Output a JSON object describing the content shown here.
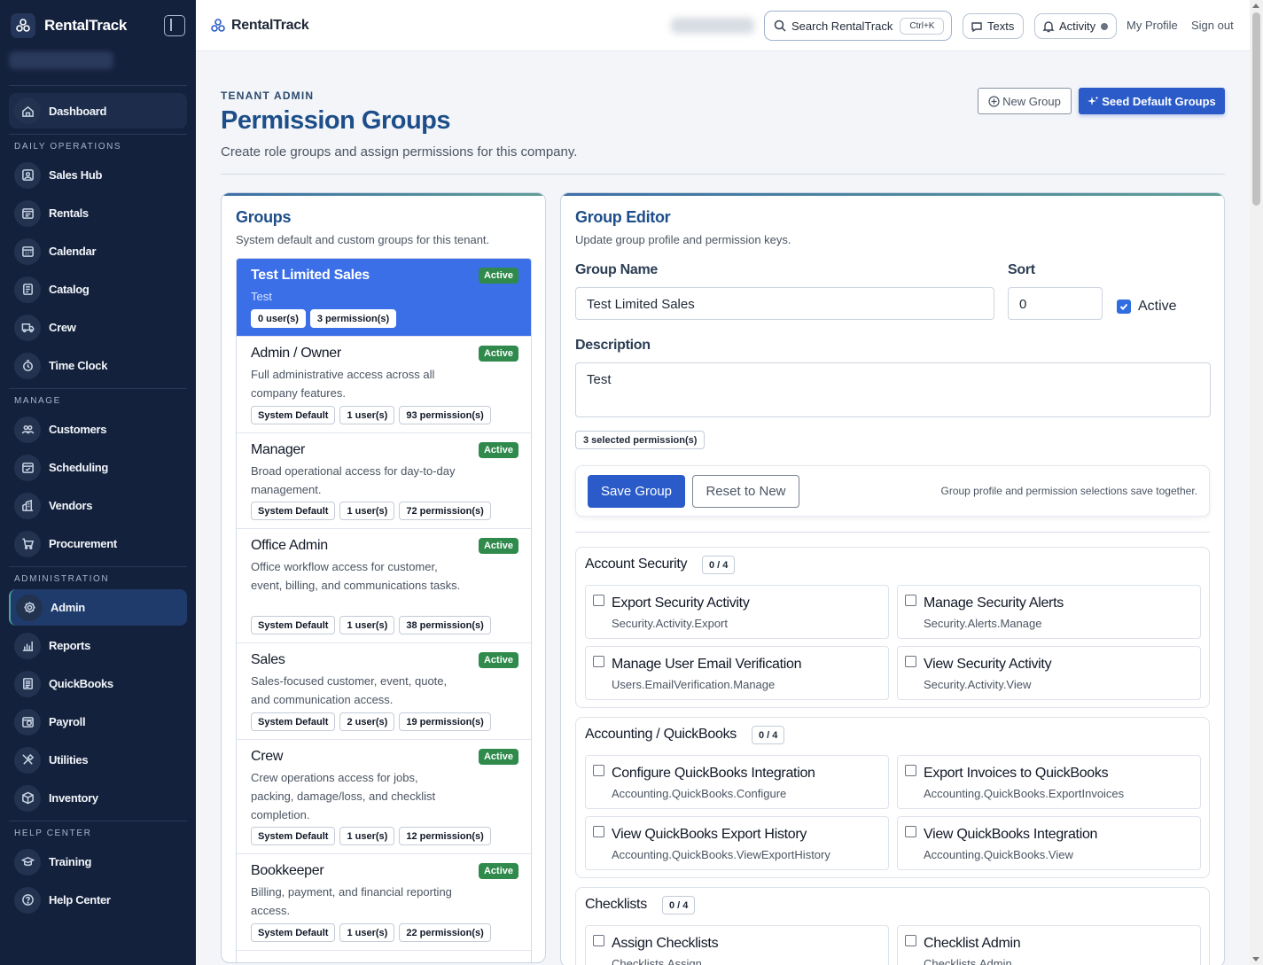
{
  "app": {
    "name": "RentalTrack"
  },
  "sidebar": {
    "dashboard": "Dashboard",
    "sections": [
      {
        "title": "DAILY OPERATIONS",
        "items": [
          "Sales Hub",
          "Rentals",
          "Calendar",
          "Catalog",
          "Crew",
          "Time Clock"
        ]
      },
      {
        "title": "MANAGE",
        "items": [
          "Customers",
          "Scheduling",
          "Vendors",
          "Procurement"
        ]
      },
      {
        "title": "ADMINISTRATION",
        "items": [
          "Admin",
          "Reports",
          "QuickBooks",
          "Payroll",
          "Utilities",
          "Inventory"
        ]
      },
      {
        "title": "HELP CENTER",
        "items": [
          "Training",
          "Help Center"
        ]
      }
    ],
    "active": "Admin"
  },
  "topbar": {
    "search_label": "Search RentalTrack",
    "search_shortcut": "Ctrl+K",
    "texts": "Texts",
    "activity": "Activity",
    "my_profile": "My Profile",
    "sign_out": "Sign out"
  },
  "header": {
    "eyebrow": "TENANT ADMIN",
    "title": "Permission Groups",
    "subtitle": "Create role groups and assign permissions for this company.",
    "new_group": "New Group",
    "seed_groups": "Seed Default Groups"
  },
  "groups_card": {
    "title": "Groups",
    "subtitle": "System default and custom groups for this tenant.",
    "items": [
      {
        "name": "Test Limited Sales",
        "desc": "Test",
        "badge": "Active",
        "pills": [
          "0 user(s)",
          "3 permission(s)"
        ],
        "selected": true
      },
      {
        "name": "Admin / Owner",
        "desc": "Full administrative access across all company features.",
        "badge": "Active",
        "pills": [
          "System Default",
          "1 user(s)",
          "93 permission(s)"
        ]
      },
      {
        "name": "Manager",
        "desc": "Broad operational access for day-to-day management.",
        "badge": "Active",
        "pills": [
          "System Default",
          "1 user(s)",
          "72 permission(s)"
        ]
      },
      {
        "name": "Office Admin",
        "desc": "Office workflow access for customer, event, billing, and communications tasks.",
        "badge": "Active",
        "pills": [
          "System Default",
          "1 user(s)",
          "38 permission(s)"
        ]
      },
      {
        "name": "Sales",
        "desc": "Sales-focused customer, event, quote, and communication access.",
        "badge": "Active",
        "pills": [
          "System Default",
          "2 user(s)",
          "19 permission(s)"
        ]
      },
      {
        "name": "Crew",
        "desc": "Crew operations access for jobs, packing, damage/loss, and checklist completion.",
        "badge": "Active",
        "pills": [
          "System Default",
          "1 user(s)",
          "12 permission(s)"
        ]
      },
      {
        "name": "Bookkeeper",
        "desc": "Billing, payment, and financial reporting access.",
        "badge": "Active",
        "pills": [
          "System Default",
          "1 user(s)",
          "22 permission(s)"
        ]
      }
    ]
  },
  "editor": {
    "title": "Group Editor",
    "subtitle": "Update group profile and permission keys.",
    "group_name_label": "Group Name",
    "group_name_value": "Test Limited Sales",
    "sort_label": "Sort",
    "sort_value": "0",
    "active_label": "Active",
    "description_label": "Description",
    "description_value": "Test",
    "selected_count": "3 selected permission(s)",
    "save": "Save Group",
    "reset": "Reset to New",
    "save_note": "Group profile and permission selections save together.",
    "sections": [
      {
        "title": "Account Security",
        "count": "0 / 4",
        "perms": [
          {
            "name": "Export Security Activity",
            "key": "Security.Activity.Export"
          },
          {
            "name": "Manage Security Alerts",
            "key": "Security.Alerts.Manage"
          },
          {
            "name": "Manage User Email Verification",
            "key": "Users.EmailVerification.Manage"
          },
          {
            "name": "View Security Activity",
            "key": "Security.Activity.View"
          }
        ]
      },
      {
        "title": "Accounting / QuickBooks",
        "count": "0 / 4",
        "perms": [
          {
            "name": "Configure QuickBooks Integration",
            "key": "Accounting.QuickBooks.Configure"
          },
          {
            "name": "Export Invoices to QuickBooks",
            "key": "Accounting.QuickBooks.ExportInvoices"
          },
          {
            "name": "View QuickBooks Export History",
            "key": "Accounting.QuickBooks.ViewExportHistory"
          },
          {
            "name": "View QuickBooks Integration",
            "key": "Accounting.QuickBooks.View"
          }
        ]
      },
      {
        "title": "Checklists",
        "count": "0 / 4",
        "perms": [
          {
            "name": "Assign Checklists",
            "key": "Checklists.Assign"
          },
          {
            "name": "Checklist Admin",
            "key": "Checklists.Admin"
          }
        ]
      }
    ]
  }
}
